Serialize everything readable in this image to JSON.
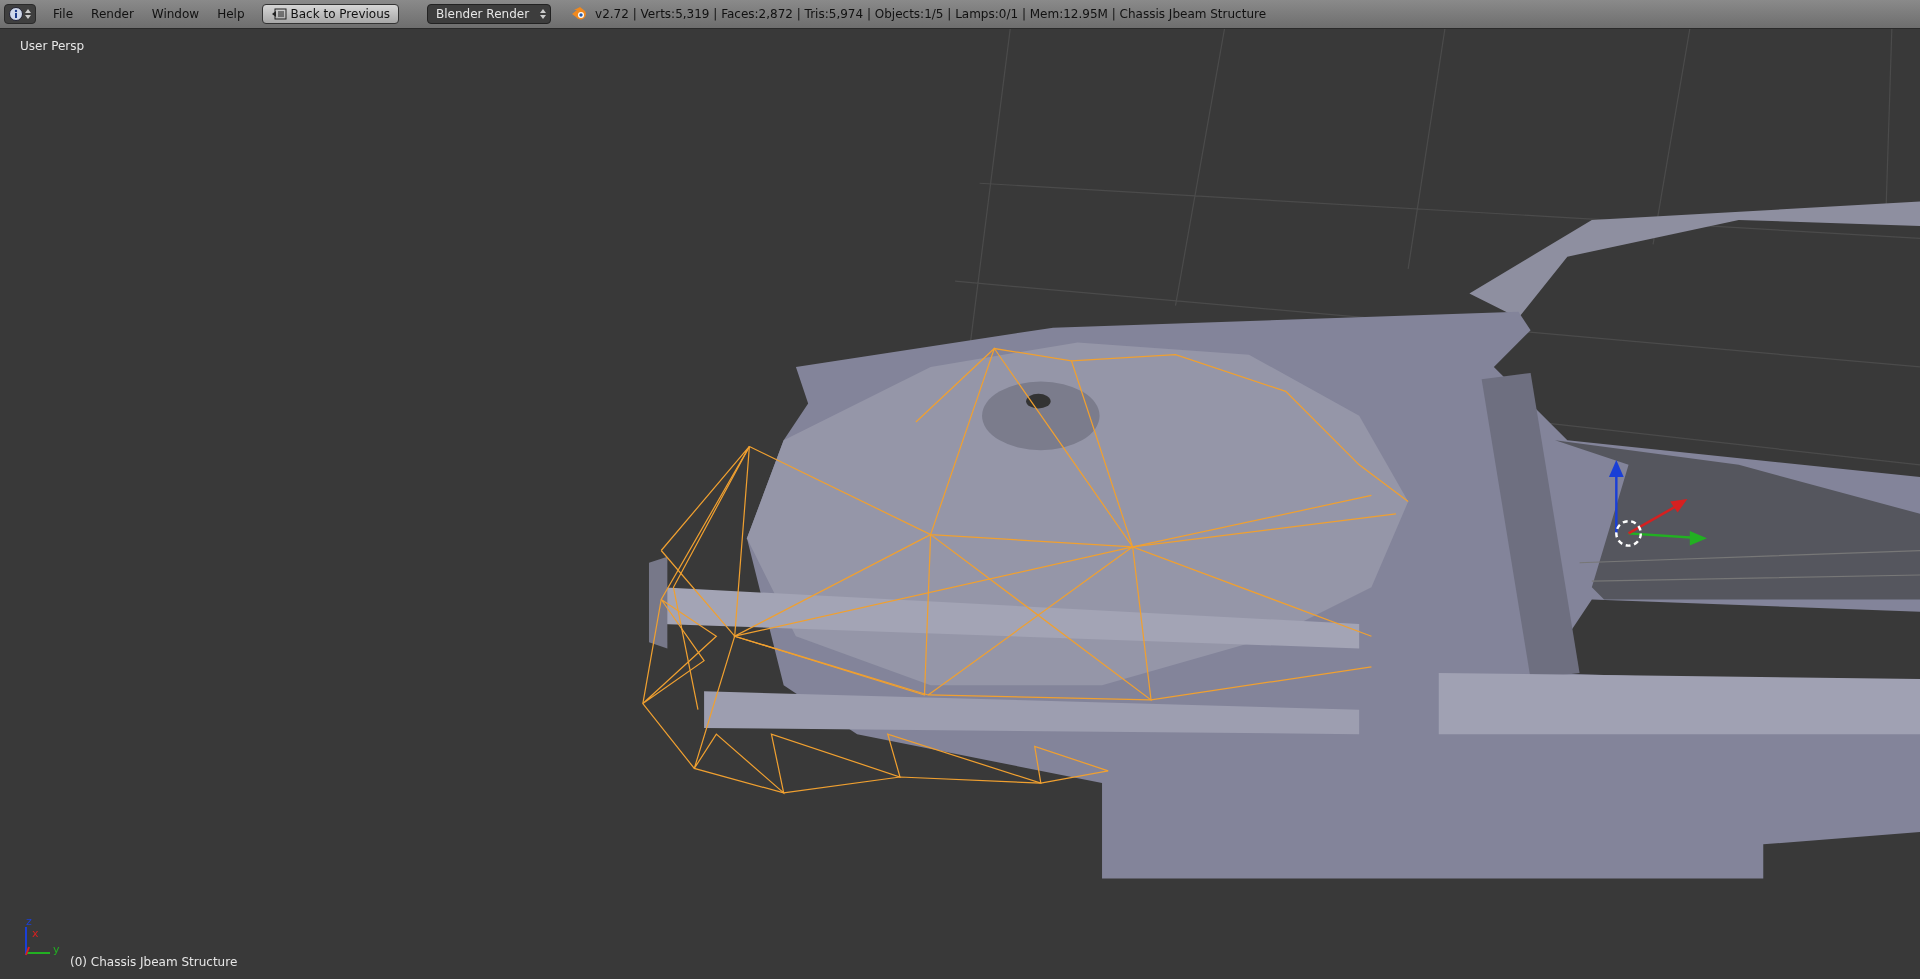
{
  "header": {
    "menus": [
      "File",
      "Render",
      "Window",
      "Help"
    ],
    "back_button": "Back to Previous",
    "render_engine": "Blender Render",
    "stats": "v2.72 | Verts:5,319 | Faces:2,872 | Tris:5,974 | Objects:1/5 | Lamps:0/1 | Mem:12.95M | Chassis Jbeam Structure"
  },
  "viewport": {
    "view_label": "User Persp",
    "object_label": "(0) Chassis Jbeam Structure",
    "axes": [
      "z",
      "x",
      "y"
    ]
  }
}
